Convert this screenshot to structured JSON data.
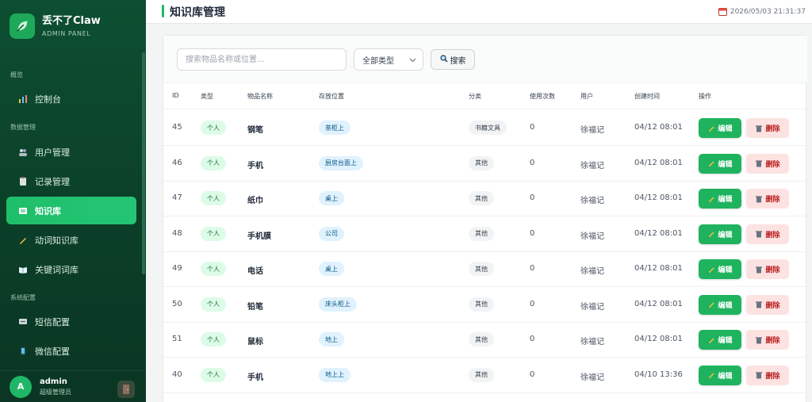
{
  "brand": {
    "name": "丢不了Claw",
    "subtitle": "ADMIN PANEL"
  },
  "sidebar": {
    "sections": [
      {
        "label": "概览"
      },
      {
        "label": "数据管理"
      },
      {
        "label": "系统配置"
      }
    ],
    "items": [
      {
        "label": "控制台",
        "icon": "chart-icon"
      },
      {
        "label": "用户管理",
        "icon": "users-icon"
      },
      {
        "label": "记录管理",
        "icon": "clipboard-icon"
      },
      {
        "label": "知识库",
        "icon": "book-icon",
        "active": true
      },
      {
        "label": "动词知识库",
        "icon": "pencil-icon"
      },
      {
        "label": "关键词词库",
        "icon": "open-book-icon"
      },
      {
        "label": "短信配置",
        "icon": "message-icon"
      },
      {
        "label": "微信配置",
        "icon": "phone-icon"
      }
    ]
  },
  "user": {
    "initial": "A",
    "name": "admin",
    "role": "超级管理员"
  },
  "header": {
    "title": "知识库管理",
    "datetime": "2026/05/03 21:31:37"
  },
  "toolbar": {
    "search_placeholder": "搜索物品名称或位置...",
    "type_select": "全部类型",
    "search_label": "搜索"
  },
  "table": {
    "columns": [
      "ID",
      "类型",
      "物品名称",
      "存放位置",
      "分类",
      "使用次数",
      "用户",
      "创建时间",
      "操作"
    ],
    "edit_label": "编辑",
    "delete_label": "删除",
    "rows": [
      {
        "id": "45",
        "type": "个人",
        "name": "钢笔",
        "location": "茶柜上",
        "category": "书籍文具",
        "uses": "0",
        "user": "徐福记",
        "created": "04/12 08:01"
      },
      {
        "id": "46",
        "type": "个人",
        "name": "手机",
        "location": "厨房台面上",
        "category": "其他",
        "uses": "0",
        "user": "徐福记",
        "created": "04/12 08:01"
      },
      {
        "id": "47",
        "type": "个人",
        "name": "纸巾",
        "location": "桌上",
        "category": "其他",
        "uses": "0",
        "user": "徐福记",
        "created": "04/12 08:01"
      },
      {
        "id": "48",
        "type": "个人",
        "name": "手机膜",
        "location": "公司",
        "category": "其他",
        "uses": "0",
        "user": "徐福记",
        "created": "04/12 08:01"
      },
      {
        "id": "49",
        "type": "个人",
        "name": "电话",
        "location": "桌上",
        "category": "其他",
        "uses": "0",
        "user": "徐福记",
        "created": "04/12 08:01"
      },
      {
        "id": "50",
        "type": "个人",
        "name": "铅笔",
        "location": "床头柜上",
        "category": "其他",
        "uses": "0",
        "user": "徐福记",
        "created": "04/12 08:01"
      },
      {
        "id": "51",
        "type": "个人",
        "name": "鼠标",
        "location": "地上",
        "category": "其他",
        "uses": "0",
        "user": "徐福记",
        "created": "04/12 08:01"
      },
      {
        "id": "40",
        "type": "个人",
        "name": "手机",
        "location": "地上上",
        "category": "其他",
        "uses": "0",
        "user": "徐福记",
        "created": "04/10 13:36"
      }
    ]
  },
  "colors": {
    "accent": "#1fb767",
    "sidebar_bg": "#0d4f32",
    "delete_bg": "#fde2e2"
  }
}
